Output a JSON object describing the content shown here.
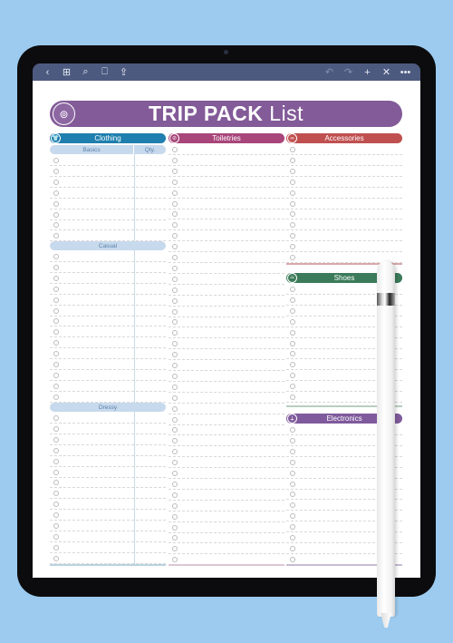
{
  "toolbar": {
    "left_icons": [
      "back-icon",
      "grid-icon",
      "search-icon",
      "bookmark-icon",
      "share-icon"
    ],
    "right_icons": [
      "undo-icon",
      "redo-icon",
      "add-icon",
      "close-icon",
      "more-icon"
    ],
    "glyphs": {
      "back": "‹",
      "grid": "⊞",
      "search": "⌕",
      "bookmark": "⎕",
      "share": "⇪",
      "undo": "↶",
      "redo": "↷",
      "add": "+",
      "close": "✕",
      "more": "•••"
    }
  },
  "header": {
    "title_bold": "TRIP PACK",
    "title_light": "List",
    "logo_glyph": "⊚"
  },
  "colors": {
    "title": "#835b98",
    "clothing": "#1f7fae",
    "toiletries": "#a8457a",
    "accessories": "#c05050",
    "shoes": "#3b7a5a",
    "electronics": "#7f5a9c",
    "subhead": "#c7d9ec"
  },
  "sections": {
    "clothing": {
      "label": "Clothing",
      "icon": "shirt-icon",
      "glyph": "👕",
      "col_basics": "Basics",
      "col_qty": "Qty.",
      "sub_casual": "Casual",
      "sub_dressy": "Dressy"
    },
    "toiletries": {
      "label": "Toiletries",
      "icon": "razor-icon",
      "glyph": "⊘"
    },
    "accessories": {
      "label": "Accessories",
      "icon": "glasses-icon",
      "glyph": "∞"
    },
    "shoes": {
      "label": "Shoes",
      "icon": "shoe-icon",
      "glyph": "⌓"
    },
    "electronics": {
      "label": "Electronics",
      "icon": "plug-icon",
      "glyph": "⏚"
    }
  }
}
